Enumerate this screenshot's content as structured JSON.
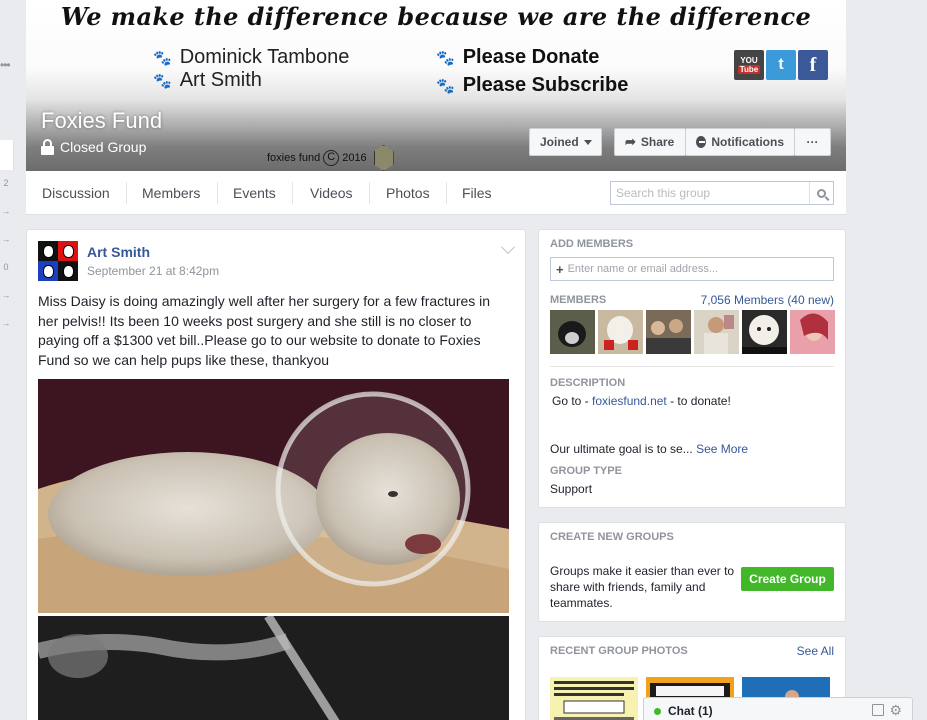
{
  "cover": {
    "slogan": "We make the difference because we are the difference",
    "names": [
      "Dominick Tambone",
      "Art Smith"
    ],
    "calls": [
      "Please Donate",
      "Please Subscribe"
    ],
    "copyright_text": "foxies fund",
    "copyright_symbol": "C",
    "copyright_year": "2016",
    "social": {
      "youtube_top": "YOU",
      "youtube_bottom": "Tube",
      "twitter": "t",
      "facebook": "f"
    }
  },
  "group": {
    "name": "Foxies Fund",
    "privacy": "Closed Group"
  },
  "actions": {
    "joined": "Joined",
    "share": "Share",
    "notifications": "Notifications",
    "more": "···"
  },
  "tabs": [
    "Discussion",
    "Members",
    "Events",
    "Videos",
    "Photos",
    "Files"
  ],
  "search": {
    "placeholder": "Search this group"
  },
  "post": {
    "author": "Art Smith",
    "time": "September 21 at 8:42pm",
    "text": "Miss Daisy is doing amazingly well after her surgery for a few fractures in her pelvis!! Its been 10 weeks post surgery and she still is no closer to paying off a $1300 vet bill..Please go to our website to donate to Foxies Fund so we can help pups like these, thankyou"
  },
  "sidebar": {
    "add_members": {
      "title": "ADD MEMBERS",
      "placeholder": "Enter name or email address..."
    },
    "members": {
      "title": "MEMBERS",
      "count": "7,056 Members",
      "new": "(40 new)"
    },
    "description": {
      "title": "DESCRIPTION",
      "line1_prefix": "Go to -",
      "link": "foxiesfund.net",
      "line1_suffix": "- to donate!",
      "line2": "Our ultimate goal is to se...",
      "see_more": "See More"
    },
    "group_type": {
      "title": "GROUP TYPE",
      "value": "Support"
    },
    "create_groups": {
      "title": "CREATE NEW GROUPS",
      "text": "Groups make it easier than ever to share with friends, family and teammates.",
      "button": "Create Group"
    },
    "recent_photos": {
      "title": "RECENT GROUP PHOTOS",
      "see_all": "See All"
    }
  },
  "chat": {
    "label": "Chat (1)"
  },
  "left_rail": {
    "numbers": [
      "2",
      "0"
    ]
  }
}
